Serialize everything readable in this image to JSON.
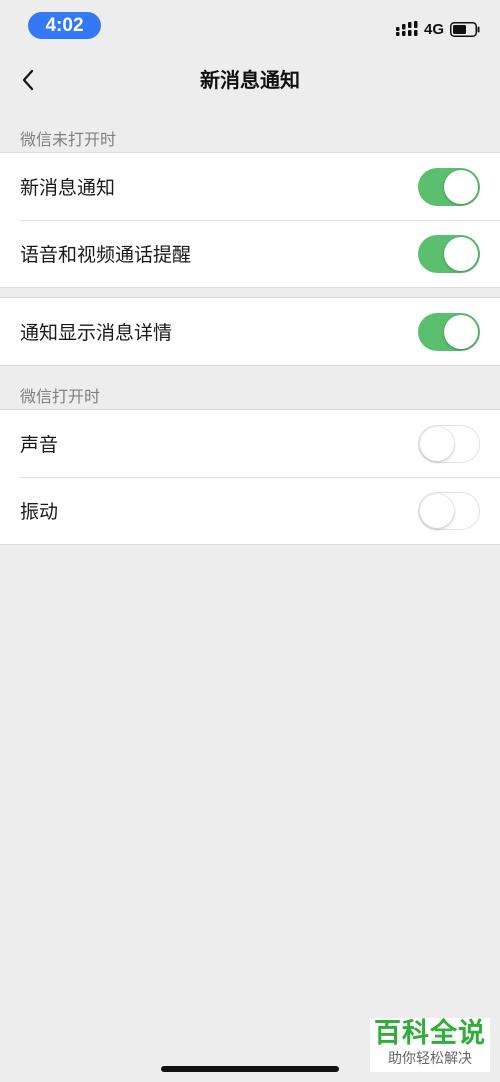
{
  "status_bar": {
    "time": "4:02",
    "network": "4G",
    "icons": [
      "signal-icon",
      "battery-icon"
    ]
  },
  "nav": {
    "title": "新消息通知",
    "back_icon": "chevron-left-icon"
  },
  "sections": [
    {
      "header": "微信未打开时",
      "rows": [
        {
          "label": "新消息通知",
          "enabled": true
        },
        {
          "label": "语音和视频通话提醒",
          "enabled": true
        }
      ]
    },
    {
      "header": "",
      "rows": [
        {
          "label": "通知显示消息详情",
          "enabled": true
        }
      ]
    },
    {
      "header": "微信打开时",
      "rows": [
        {
          "label": "声音",
          "enabled": false
        },
        {
          "label": "振动",
          "enabled": false
        }
      ]
    }
  ],
  "watermark": {
    "title": "百科全说",
    "subtitle": "助你轻松解决"
  },
  "colors": {
    "accent_toggle_on": "#5ac06f",
    "time_pill": "#3478f6",
    "background": "#ededed",
    "watermark_green": "#2fae3a"
  }
}
